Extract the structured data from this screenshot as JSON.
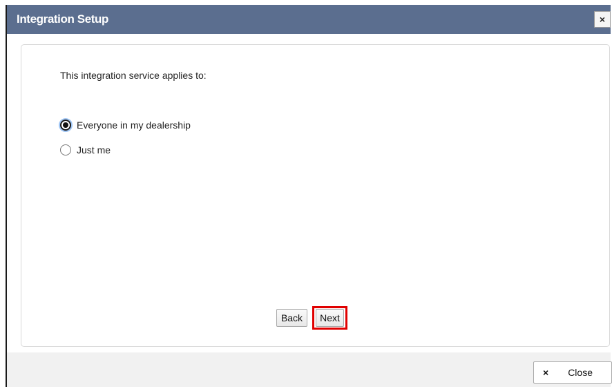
{
  "dialog": {
    "title": "Integration Setup",
    "close_x_label": "×"
  },
  "content": {
    "question": "This integration service applies to:",
    "options": [
      {
        "label": "Everyone in my dealership",
        "checked": true
      },
      {
        "label": "Just me",
        "checked": false
      }
    ]
  },
  "buttons": {
    "back_label": "Back",
    "next_label": "Next"
  },
  "footer": {
    "close_icon": "×",
    "close_label": "Close"
  },
  "colors": {
    "titlebar": "#5b6e8f",
    "highlight": "#e00000",
    "focus_ring": "#9ec5f5"
  }
}
